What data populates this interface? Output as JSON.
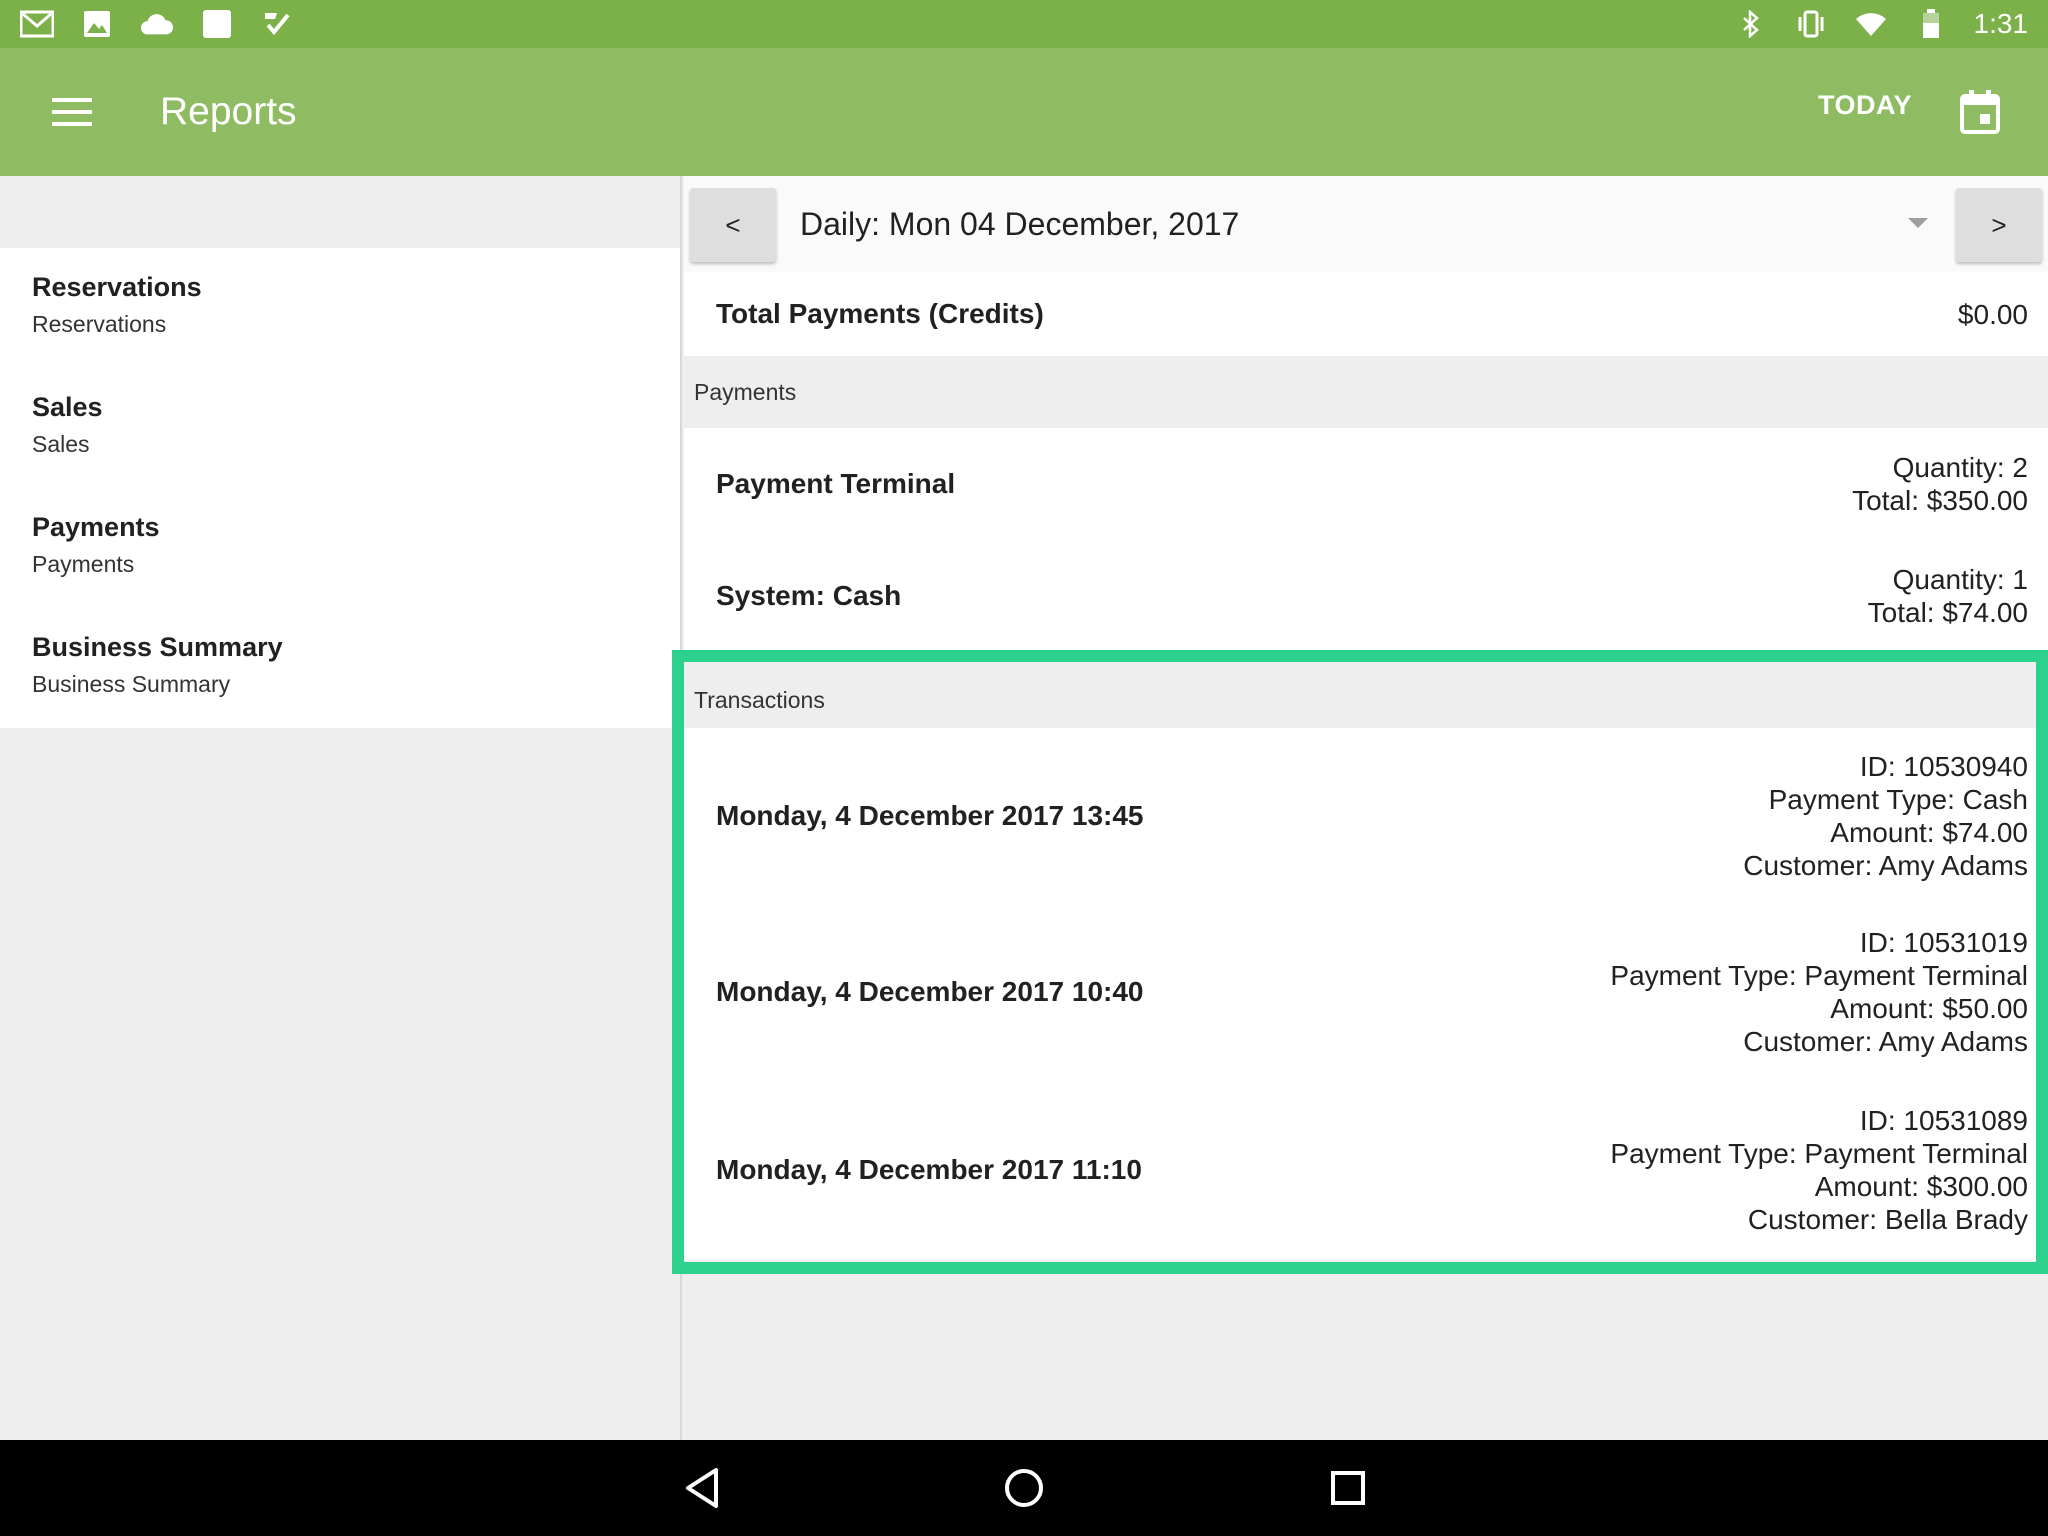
{
  "status_bar": {
    "time": "1:31",
    "left_icons": [
      "gmail-icon",
      "image-icon",
      "cloud-icon",
      "square-icon",
      "checkmark-icon"
    ],
    "right_icons": [
      "bluetooth-icon",
      "vibrate-icon",
      "wifi-icon",
      "battery-icon"
    ]
  },
  "app_bar": {
    "title": "Reports",
    "today_label": "TODAY",
    "color": "#8fbc63"
  },
  "sidebar": {
    "items": [
      {
        "title": "Reservations",
        "subtitle": "Reservations"
      },
      {
        "title": "Sales",
        "subtitle": "Sales"
      },
      {
        "title": "Payments",
        "subtitle": "Payments"
      },
      {
        "title": "Business Summary",
        "subtitle": "Business Summary"
      }
    ]
  },
  "date_nav": {
    "prev_label": "<",
    "next_label": ">",
    "selected": "Daily: Mon 04 December, 2017"
  },
  "total_payments": {
    "label": "Total Payments (Credits)",
    "value": "$0.00"
  },
  "payments": {
    "header": "Payments",
    "items": [
      {
        "name": "Payment Terminal",
        "quantity": "Quantity: 2",
        "total": "Total: $350.00"
      },
      {
        "name": "System: Cash",
        "quantity": "Quantity: 1",
        "total": "Total: $74.00"
      }
    ]
  },
  "transactions": {
    "header": "Transactions",
    "items": [
      {
        "date": "Monday, 4 December 2017 13:45",
        "id": "ID: 10530940",
        "type": "Payment Type: Cash",
        "amount": "Amount: $74.00",
        "customer": "Customer: Amy Adams"
      },
      {
        "date": "Monday, 4 December 2017 10:40",
        "id": "ID: 10531019",
        "type": "Payment Type: Payment Terminal",
        "amount": "Amount: $50.00",
        "customer": "Customer: Amy Adams"
      },
      {
        "date": "Monday, 4 December 2017 11:10",
        "id": "ID: 10531089",
        "type": "Payment Type: Payment Terminal",
        "amount": "Amount: $300.00",
        "customer": "Customer: Bella Brady"
      }
    ]
  },
  "highlight_color": "#2dd18e"
}
